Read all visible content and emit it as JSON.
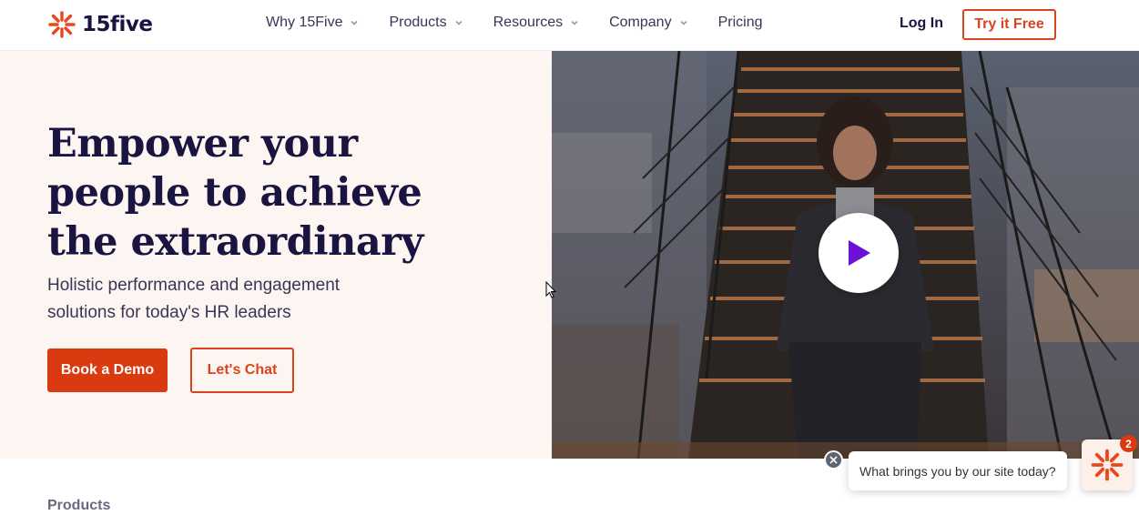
{
  "header": {
    "logo_text": "15five",
    "nav": [
      {
        "label": "Why 15Five",
        "has_dropdown": true
      },
      {
        "label": "Products",
        "has_dropdown": true
      },
      {
        "label": "Resources",
        "has_dropdown": true
      },
      {
        "label": "Company",
        "has_dropdown": true
      },
      {
        "label": "Pricing",
        "has_dropdown": false
      }
    ],
    "login_label": "Log In",
    "try_label": "Try it Free"
  },
  "hero": {
    "title_line1": "Empower your",
    "title_line2": "people to achieve",
    "title_line3": "the extraordinary",
    "subtitle_line1": "Holistic performance and engagement",
    "subtitle_line2": "solutions for today's HR leaders",
    "demo_label": "Book a Demo",
    "chat_label": "Let's Chat"
  },
  "below": {
    "products_label": "Products"
  },
  "chat_widget": {
    "message": "What brings you by our site today?",
    "badge_count": "2"
  },
  "colors": {
    "brand_orange": "#d93a0f",
    "navy": "#1a1440",
    "hero_bg": "#fdf5f1",
    "play_purple": "#6b12d6"
  },
  "icons": [
    "logo-burst-icon",
    "chevron-down-icon",
    "play-icon",
    "close-icon",
    "chat-logo-icon"
  ]
}
